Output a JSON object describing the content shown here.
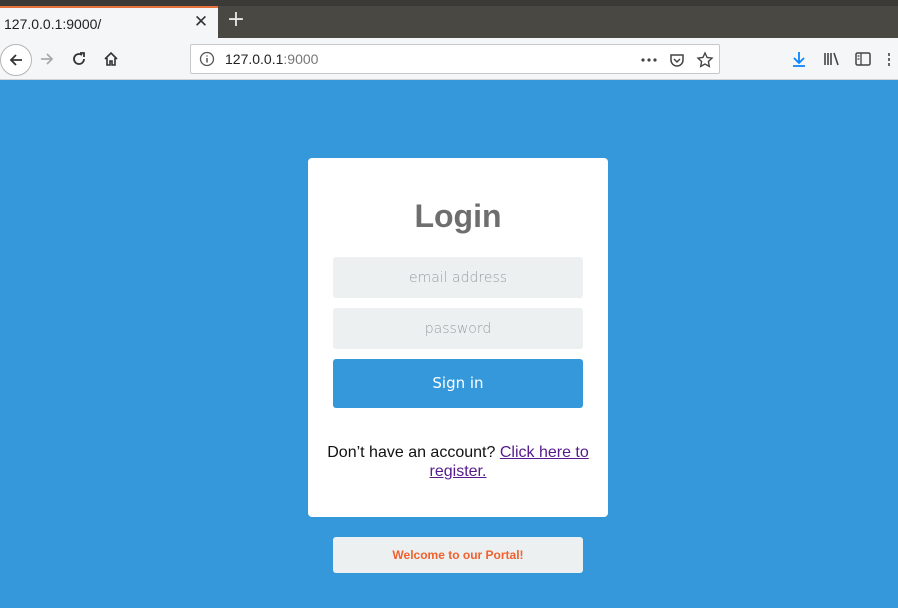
{
  "browser": {
    "tab_title": "127.0.0.1:9000/",
    "url_host": "127.0.0.1",
    "url_port": ":9000",
    "icons": [
      "back-icon",
      "forward-icon",
      "reload-icon",
      "home-icon",
      "info-icon",
      "more-icon",
      "pocket-icon",
      "bookmark-star-icon",
      "download-icon",
      "library-icon",
      "sidebar-icon"
    ]
  },
  "login": {
    "title": "Login",
    "email_placeholder": "email address",
    "password_placeholder": "password",
    "signin_label": "Sign in",
    "register_prefix": "Don’t have an account?",
    "register_link": "Click here to register."
  },
  "footer": {
    "welcome": "Welcome to our Portal!"
  },
  "colors": {
    "background": "#3498db",
    "button": "#3498db",
    "field": "#ecf0f1",
    "welcome_text": "#f0612e",
    "link": "#551a8b"
  }
}
